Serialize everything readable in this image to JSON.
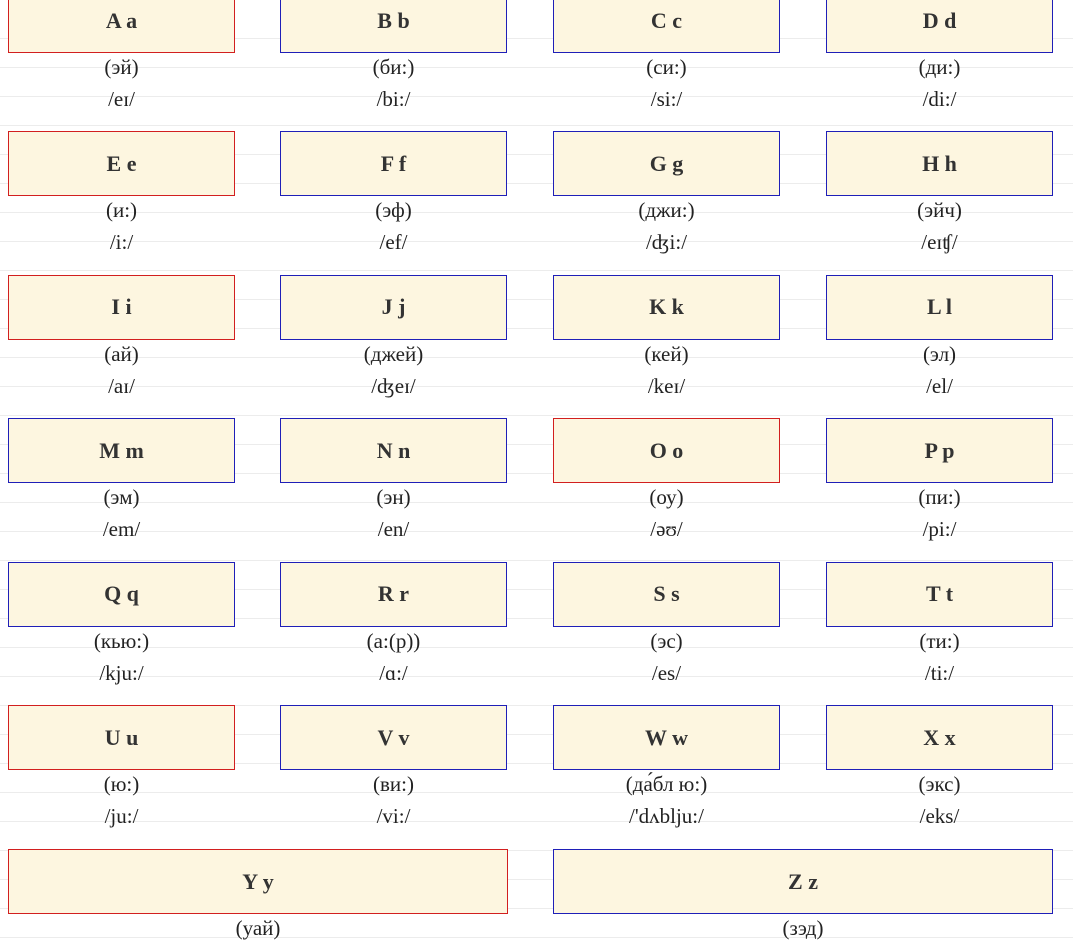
{
  "letters": [
    {
      "name": "A a",
      "rus": "(эй)",
      "ipa": "/eɪ/",
      "vowel": true
    },
    {
      "name": "B b",
      "rus": "(би:)",
      "ipa": "/bi:/",
      "vowel": false
    },
    {
      "name": "C c",
      "rus": "(си:)",
      "ipa": "/si:/",
      "vowel": false
    },
    {
      "name": "D d",
      "rus": "(ди:)",
      "ipa": "/di:/",
      "vowel": false
    },
    {
      "name": "E e",
      "rus": "(и:)",
      "ipa": "/i:/",
      "vowel": true
    },
    {
      "name": "F f",
      "rus": "(эф)",
      "ipa": "/ef/",
      "vowel": false
    },
    {
      "name": "G g",
      "rus": "(джи:)",
      "ipa": "/ʤi:/",
      "vowel": false
    },
    {
      "name": "H h",
      "rus": "(эйч)",
      "ipa": "/eɪʧ/",
      "vowel": false
    },
    {
      "name": "I i",
      "rus": "(ай)",
      "ipa": "/aɪ/",
      "vowel": true
    },
    {
      "name": "J j",
      "rus": "(джей)",
      "ipa": "/ʤeɪ/",
      "vowel": false
    },
    {
      "name": "K k",
      "rus": "(кей)",
      "ipa": "/keɪ/",
      "vowel": false
    },
    {
      "name": "L l",
      "rus": "(эл)",
      "ipa": "/el/",
      "vowel": false
    },
    {
      "name": "M m",
      "rus": "(эм)",
      "ipa": "/em/",
      "vowel": false
    },
    {
      "name": "N n",
      "rus": "(эн)",
      "ipa": "/en/",
      "vowel": false
    },
    {
      "name": "O o",
      "rus": "(оу)",
      "ipa": "/əʊ/",
      "vowel": true
    },
    {
      "name": "P p",
      "rus": "(пи:)",
      "ipa": "/pi:/",
      "vowel": false
    },
    {
      "name": "Q q",
      "rus": "(кью:)",
      "ipa": "/kju:/",
      "vowel": false
    },
    {
      "name": "R r",
      "rus": "(а:(р))",
      "ipa": "/ɑ:/",
      "vowel": false
    },
    {
      "name": "S s",
      "rus": "(эс)",
      "ipa": "/es/",
      "vowel": false
    },
    {
      "name": "T t",
      "rus": "(ти:)",
      "ipa": "/ti:/",
      "vowel": false
    },
    {
      "name": "U u",
      "rus": "(ю:)",
      "ipa": "/ju:/",
      "vowel": true
    },
    {
      "name": "V v",
      "rus": "(ви:)",
      "ipa": "/vi:/",
      "vowel": false
    },
    {
      "name": "W w",
      "rus": "(да́бл ю:)",
      "ipa": "/'dʌblju:/",
      "vowel": false
    },
    {
      "name": "X x",
      "rus": "(экс)",
      "ipa": "/eks/",
      "vowel": false
    },
    {
      "name": "Y y",
      "rus": "(уай)",
      "ipa": "",
      "vowel": true
    },
    {
      "name": "Z z",
      "rus": "(зэд)",
      "ipa": "",
      "vowel": false
    }
  ],
  "colors": {
    "card_fill": "#fdf6e0",
    "consonant_border": "#1f1fb8",
    "vowel_border": "#d21f1f"
  }
}
